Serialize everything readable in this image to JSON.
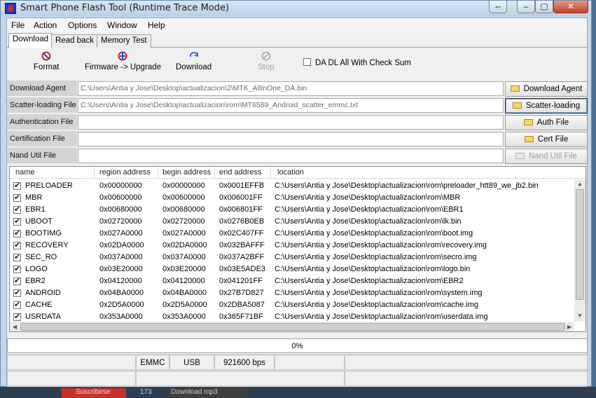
{
  "window": {
    "title": "Smart Phone Flash Tool (Runtime Trace Mode)",
    "restore_glyph": "⇔",
    "min_glyph": "–",
    "max_glyph": "▢",
    "close_glyph": "✕"
  },
  "menu": [
    "File",
    "Action",
    "Options",
    "Window",
    "Help"
  ],
  "tabs": [
    "Download",
    "Read back",
    "Memory Test"
  ],
  "toolbar": {
    "format": "Format",
    "firmware_upgrade": "Firmware -> Upgrade",
    "download": "Download",
    "stop": "Stop",
    "da_checksum": "DA DL All With Check Sum"
  },
  "files": {
    "download_agent": {
      "label": "Download Agent",
      "value": "C:\\Users\\Antia y Jose\\Desktop\\actualizacion\\2\\MTK_AllInOne_DA.bin",
      "button": "Download Agent"
    },
    "scatter": {
      "label": "Scatter-loading File",
      "value": "C:\\Users\\Antia y Jose\\Desktop\\actualizacion\\rom\\MT6589_Android_scatter_emmc.txt",
      "button": "Scatter-loading"
    },
    "auth": {
      "label": "Authentication File",
      "value": "",
      "button": "Auth File"
    },
    "cert": {
      "label": "Certification File",
      "value": "",
      "button": "Cert File"
    },
    "nand": {
      "label": "Nand Util File",
      "value": "",
      "button": "Nand Util File"
    }
  },
  "table": {
    "headers": [
      "name",
      "region address",
      "begin address",
      "end address",
      "location"
    ],
    "rows": [
      {
        "name": "PRELOADER",
        "region": "0x00000000",
        "begin": "0x00000000",
        "end": "0x0001EFFB",
        "location": "C:\\Users\\Antia y Jose\\Desktop\\actualizacion\\rom\\preloader_htt89_we_jb2.bin"
      },
      {
        "name": "MBR",
        "region": "0x00600000",
        "begin": "0x00600000",
        "end": "0x006001FF",
        "location": "C:\\Users\\Antia y Jose\\Desktop\\actualizacion\\rom\\MBR"
      },
      {
        "name": "EBR1",
        "region": "0x00680000",
        "begin": "0x00680000",
        "end": "0x006801FF",
        "location": "C:\\Users\\Antia y Jose\\Desktop\\actualizacion\\rom\\EBR1"
      },
      {
        "name": "UBOOT",
        "region": "0x02720000",
        "begin": "0x02720000",
        "end": "0x0276B0EB",
        "location": "C:\\Users\\Antia y Jose\\Desktop\\actualizacion\\rom\\lk.bin"
      },
      {
        "name": "BOOTIMG",
        "region": "0x027A0000",
        "begin": "0x027A0000",
        "end": "0x02C407FF",
        "location": "C:\\Users\\Antia y Jose\\Desktop\\actualizacion\\rom\\boot.img"
      },
      {
        "name": "RECOVERY",
        "region": "0x02DA0000",
        "begin": "0x02DA0000",
        "end": "0x032BAFFF",
        "location": "C:\\Users\\Antia y Jose\\Desktop\\actualizacion\\rom\\recovery.img"
      },
      {
        "name": "SEC_RO",
        "region": "0x037A0000",
        "begin": "0x037A0000",
        "end": "0x037A2BFF",
        "location": "C:\\Users\\Antia y Jose\\Desktop\\actualizacion\\rom\\secro.img"
      },
      {
        "name": "LOGO",
        "region": "0x03E20000",
        "begin": "0x03E20000",
        "end": "0x03E5ADE3",
        "location": "C:\\Users\\Antia y Jose\\Desktop\\actualizacion\\rom\\logo.bin"
      },
      {
        "name": "EBR2",
        "region": "0x04120000",
        "begin": "0x04120000",
        "end": "0x041201FF",
        "location": "C:\\Users\\Antia y Jose\\Desktop\\actualizacion\\rom\\EBR2"
      },
      {
        "name": "ANDROID",
        "region": "0x04BA0000",
        "begin": "0x04BA0000",
        "end": "0x27B7D827",
        "location": "C:\\Users\\Antia y Jose\\Desktop\\actualizacion\\rom\\system.img"
      },
      {
        "name": "CACHE",
        "region": "0x2D5A0000",
        "begin": "0x2D5A0000",
        "end": "0x2DBA5087",
        "location": "C:\\Users\\Antia y Jose\\Desktop\\actualizacion\\rom\\cache.img"
      },
      {
        "name": "USRDATA",
        "region": "0x353A0000",
        "begin": "0x353A0000",
        "end": "0x365F71BF",
        "location": "C:\\Users\\Antia y Jose\\Desktop\\actualizacion\\rom\\userdata.img"
      }
    ]
  },
  "progress": {
    "text": "0%"
  },
  "status": {
    "storage": "EMMC",
    "port": "USB",
    "baud": "921600 bps"
  },
  "background": {
    "subscribe": "Suscribirse",
    "count": "173",
    "download_mp3": "Download mp3"
  }
}
